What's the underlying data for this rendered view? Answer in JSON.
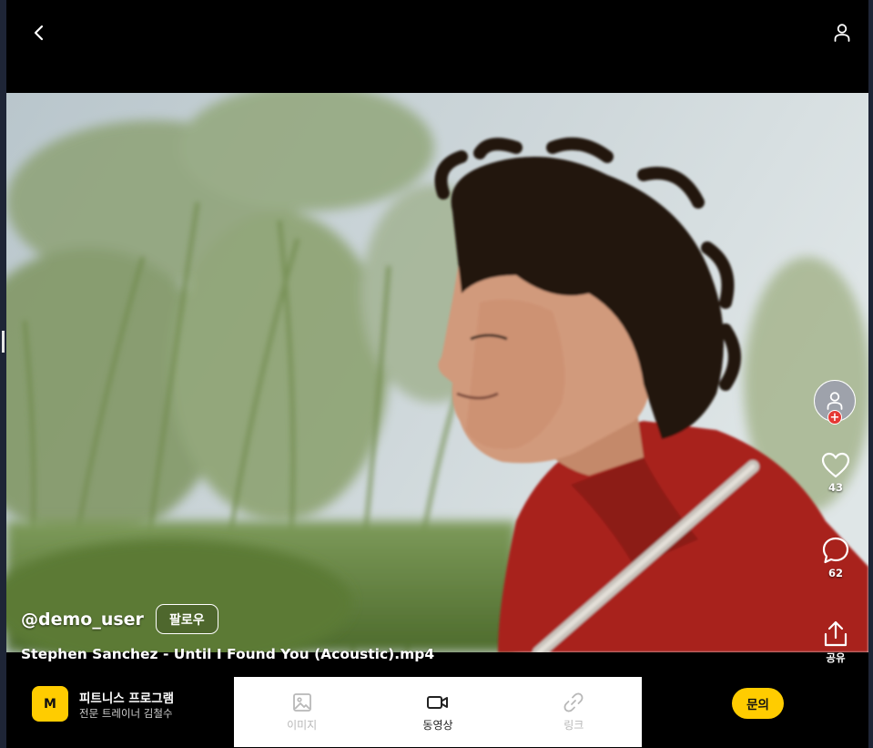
{
  "video": {
    "username": "@demo_user",
    "follow_label": "팔로우",
    "title": "Stephen Sanchez - Until I Found You (Acoustic).mp4"
  },
  "actions": {
    "likes": "43",
    "comments": "62",
    "share_label": "공유",
    "add_badge": "+"
  },
  "bottom": {
    "logo_letter": "M",
    "brand_title": "피트니스 프로그램",
    "brand_subtitle": "전문 트레이너 김철수",
    "tabs": [
      {
        "label": "이미지",
        "icon": "image-icon",
        "active": false
      },
      {
        "label": "동영상",
        "icon": "video-camera-icon",
        "active": true
      },
      {
        "label": "링크",
        "icon": "link-icon",
        "active": false
      }
    ],
    "inquiry_label": "문의"
  },
  "colors": {
    "accent": "#ffcc00",
    "background": "#000000",
    "badge_red": "#e53935",
    "inactive_tab": "#b8b8b8"
  }
}
